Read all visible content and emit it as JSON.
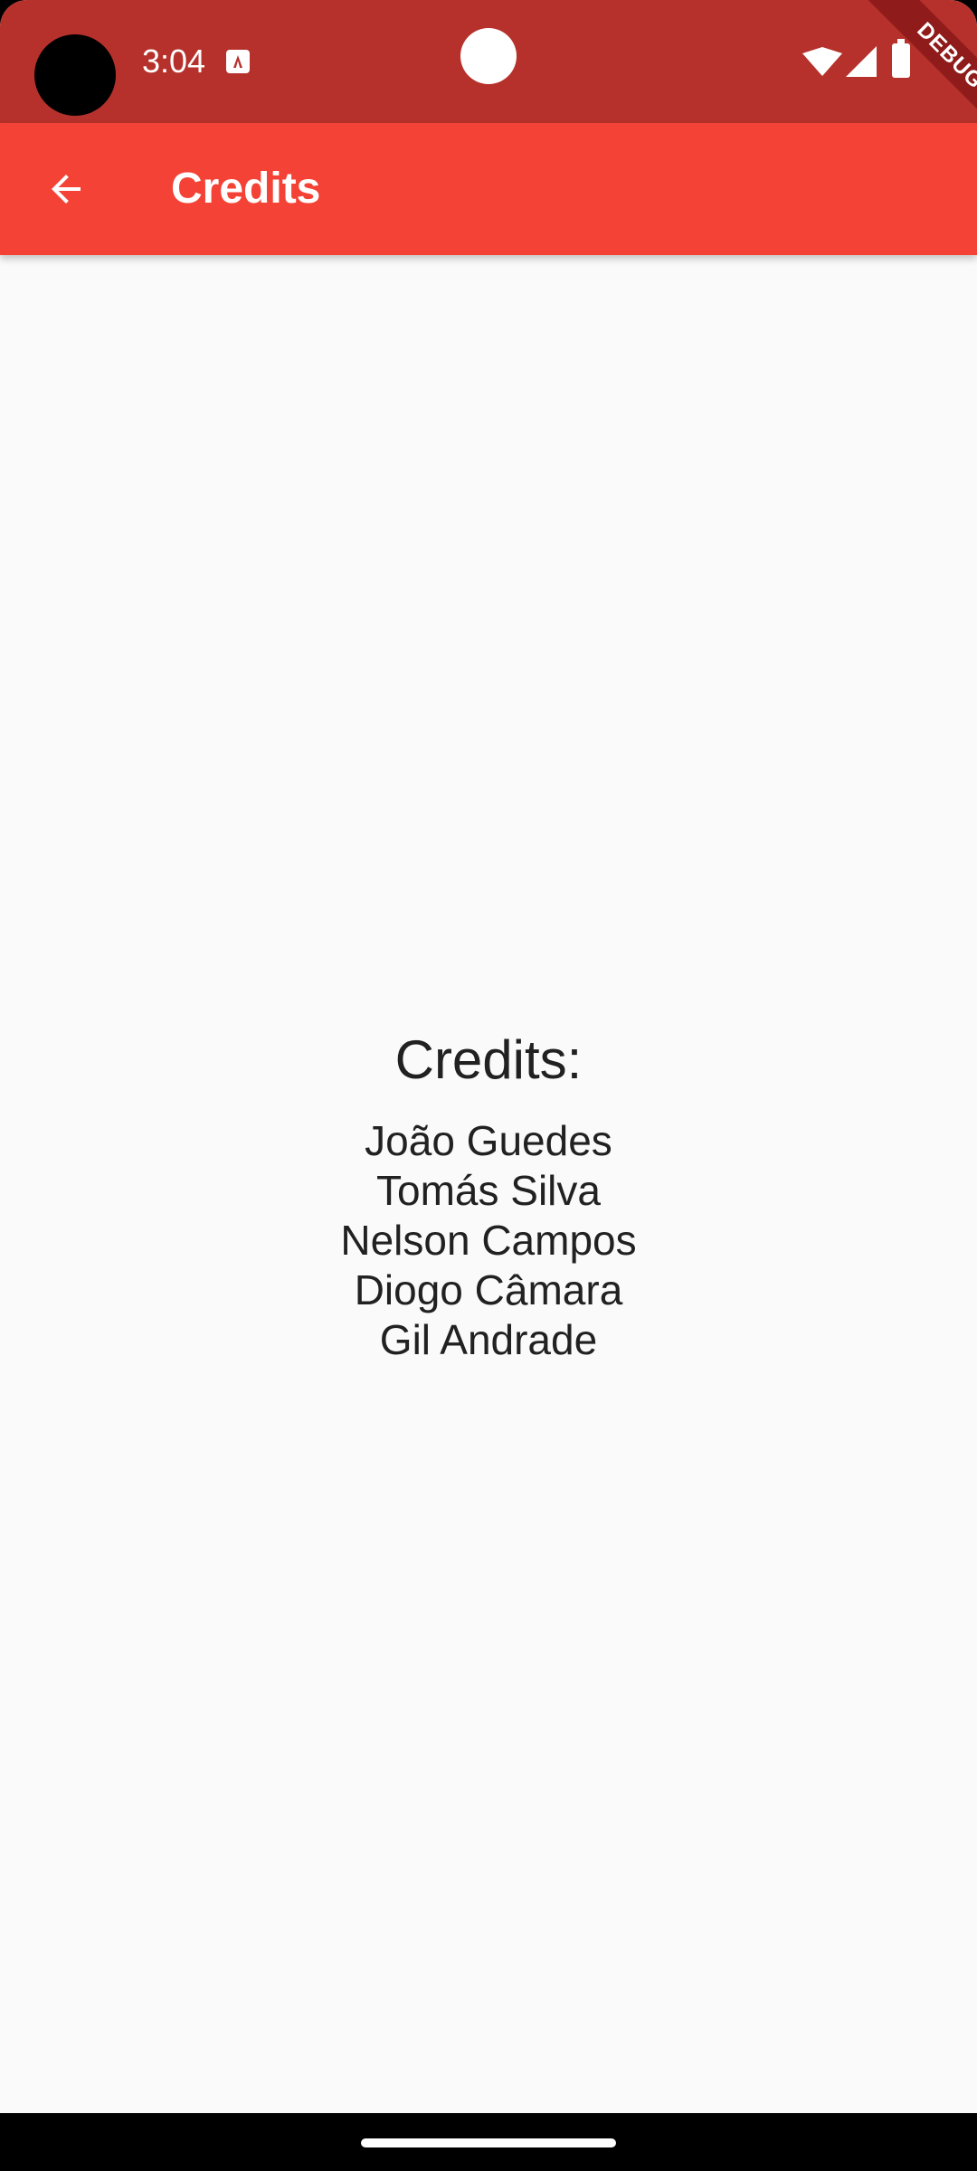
{
  "status_bar": {
    "time": "3:04",
    "icons": [
      "notification-a-icon",
      "wifi-icon",
      "cellular-signal-icon",
      "battery-icon"
    ],
    "color": "#b6312b"
  },
  "app_bar": {
    "title": "Credits",
    "back_icon": "arrow-back-icon",
    "color": "#f44336"
  },
  "debug_banner": "DEBUG",
  "credits": {
    "heading": "Credits:",
    "names": [
      "João Guedes",
      "Tomás Silva",
      "Nelson Campos",
      "Diogo Câmara",
      "Gil Andrade"
    ]
  },
  "colors": {
    "background": "#fafafa",
    "text": "#212121"
  }
}
